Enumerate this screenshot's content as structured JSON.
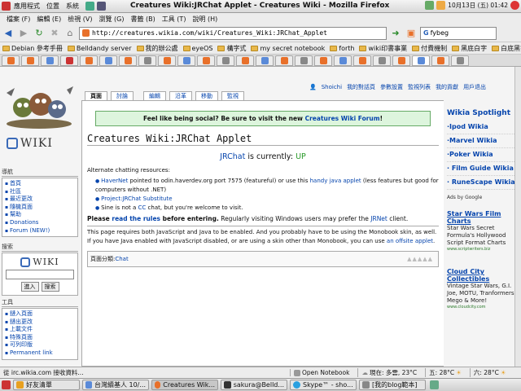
{
  "top_panel": {
    "menus": [
      "應用程式",
      "位置",
      "系統"
    ],
    "window_title": "Creatures Wiki:JRChat Applet - Creatures Wiki - Mozilla Firefox",
    "clock": "10月13日 (五) 01:42"
  },
  "menubar": [
    "檔案 (F)",
    "編輯 (E)",
    "檢視 (V)",
    "瀏覽 (G)",
    "書籤 (B)",
    "工具 (T)",
    "說明 (H)"
  ],
  "navbar": {
    "url": "http://creatures.wikia.com/wiki/Creatures_Wiki:JRChat_Applet",
    "search_value": "fybeg"
  },
  "bookmarks": [
    "Debian 參考手冊",
    "Belldandy server",
    "我的辦公處",
    "eyeOS",
    "構字式",
    "my secret notebook",
    "forth",
    "wiki印書事業",
    "付費機制",
    "黑底白字",
    "白底黑字"
  ],
  "personal_tools": [
    "Shoichi",
    "我的對話頁",
    "參數設置",
    "監視列表",
    "我的貢獻",
    "用戶退出"
  ],
  "page_tabs": [
    "頁面",
    "討論",
    "編輯",
    "沿革",
    "移動",
    "監視"
  ],
  "navigation": {
    "heading": "導航",
    "items": [
      "首頁",
      "社區",
      "最近更改",
      "隨機頁面",
      "幫助",
      "Donations",
      "Forum (NEW!)"
    ]
  },
  "search_portlet": {
    "heading": "搜索",
    "go_label": "進入",
    "search_label": "搜索"
  },
  "toolbox": {
    "heading": "工具",
    "items": [
      "鏈入頁面",
      "鏈出更改",
      "上載文件",
      "特殊頁面",
      "可列印版",
      "Permanent link"
    ]
  },
  "logo_text": "WIKI",
  "article": {
    "notice_text": "Feel like being social? Be sure to visit the new",
    "notice_link": "Creatures Wiki Forum",
    "notice_end": "!",
    "title": "Creatures Wiki:JRChat Applet",
    "status_link": "JRChat",
    "status_text": "is currently:",
    "status_value": "UP",
    "alt_heading": "Alternate chatting resources:",
    "bullets": [
      {
        "link": "HaverNet",
        "text": " pointed to odin.haverdev.org port 7575 (featureful) or use this ",
        "link2": "handy java applet",
        "text2": " (less features but good for computers without .NET)"
      },
      {
        "link": "Project:JRChat Substitute",
        "text": "",
        "link2": "",
        "text2": ""
      },
      {
        "link": "",
        "text": "Sine is not a ",
        "link2": "CC",
        "text2": " chat, but you're welcome to visit."
      }
    ],
    "rules_pre": "Please ",
    "rules_link": "read the rules",
    "rules_mid": " before entering.",
    "rules_post": " Regularly visiting Windows users may prefer the ",
    "rules_link2": "JRNet",
    "rules_end": " client.",
    "requirements": "This page requires both JavaScript and Java to be enabled. And you probably have to be using the Monobook skin, as well. If you have Java enabled with JavaScript disabled, or are using a skin other than Monobook, you can use ",
    "req_link": "an offsite applet",
    "req_end": ".",
    "category_label": "頁面分類:",
    "category_value": "Chat"
  },
  "right_column": {
    "title": "Wikia Spotlight",
    "links": [
      "·Ipod Wikia",
      "·Marvel Wikia",
      "·Poker Wikia",
      "· Film Guide Wikia",
      "· RuneScape Wikia"
    ],
    "ads_label": "Ads by Google",
    "ads": [
      {
        "head": "Star Wars Film Charts",
        "text": "Star Wars Secret Formula's Hollywood Script Format Charts",
        "url": "www.scriptwriters.biz"
      },
      {
        "head": "Cloud City Collectibles",
        "text": "Vintage Star Wars, G.I. Joe, MOTU, Tranformers, Mego & More!",
        "url": "www.cloudcity.com"
      }
    ]
  },
  "statusbar": {
    "text": "從 irc.wikia.com 接收資料...",
    "notebook": "Open Notebook",
    "weather1": "現在: 多雲, 23°C",
    "weather2": "五: 28°C",
    "weather3": "六: 28°C"
  },
  "taskbar": [
    "好友清單",
    "台灣續基人 10/...",
    "Creatures Wik...",
    "sakura@Belld...",
    "Skype™ - sho...",
    "[我的blog範本]"
  ]
}
